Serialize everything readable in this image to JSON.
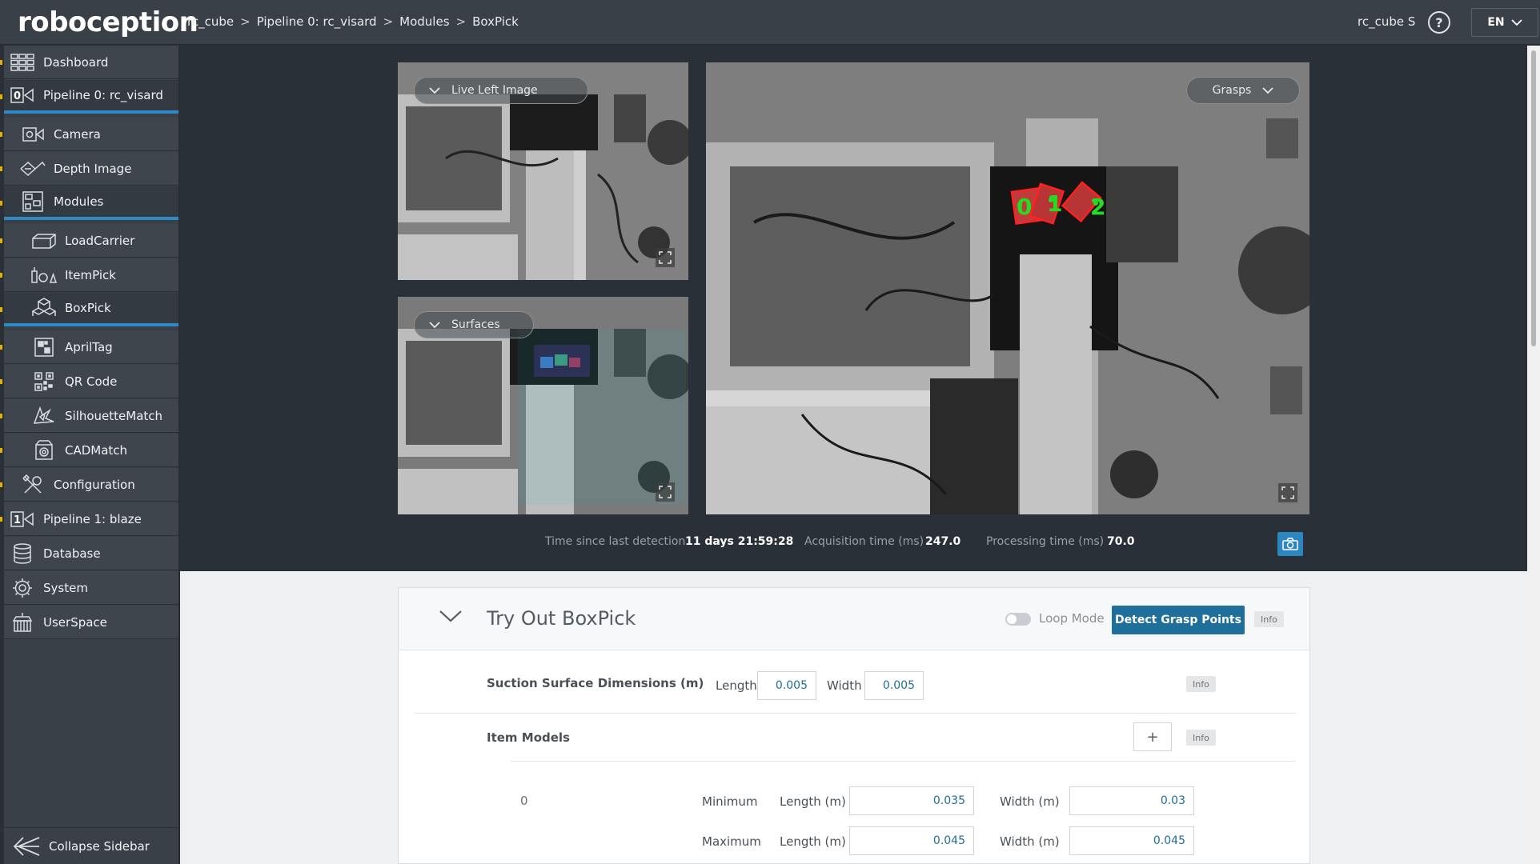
{
  "header": {
    "logo": "roboception",
    "breadcrumb": [
      "rc_cube",
      "Pipeline 0: rc_visard",
      "Modules",
      "BoxPick"
    ],
    "device": "rc_cube S",
    "help_symbol": "?",
    "language": "EN"
  },
  "sidebar": {
    "items": [
      {
        "label": "Dashboard",
        "icon": "dashboard-icon"
      },
      {
        "label": "Pipeline 0: rc_visard",
        "icon": "pipeline-0-icon",
        "badge": "0"
      },
      {
        "label": "Camera",
        "icon": "camera-icon"
      },
      {
        "label": "Depth Image",
        "icon": "depth-image-icon"
      },
      {
        "label": "Modules",
        "icon": "modules-icon"
      },
      {
        "label": "LoadCarrier",
        "icon": "load-carrier-icon"
      },
      {
        "label": "ItemPick",
        "icon": "item-pick-icon"
      },
      {
        "label": "BoxPick",
        "icon": "box-pick-icon"
      },
      {
        "label": "AprilTag",
        "icon": "april-tag-icon"
      },
      {
        "label": "QR Code",
        "icon": "qr-code-icon"
      },
      {
        "label": "SilhouetteMatch",
        "icon": "silhouette-match-icon"
      },
      {
        "label": "CADMatch",
        "icon": "cad-match-icon"
      },
      {
        "label": "Configuration",
        "icon": "configuration-icon"
      },
      {
        "label": "Pipeline 1: blaze",
        "icon": "pipeline-1-icon",
        "badge": "1"
      },
      {
        "label": "Database",
        "icon": "database-icon"
      },
      {
        "label": "System",
        "icon": "gear-icon"
      },
      {
        "label": "UserSpace",
        "icon": "userspace-icon"
      }
    ],
    "collapse_label": "Collapse Sidebar"
  },
  "viewer": {
    "left_top_dropdown": "Live Left Image",
    "left_bottom_dropdown": "Surfaces",
    "right_dropdown": "Grasps",
    "grasp_labels": [
      "0",
      "1",
      "2"
    ],
    "stats": {
      "time_label": "Time since last detection",
      "time_value": "11 days 21:59:28",
      "acq_label": "Acquisition time (ms)",
      "acq_value": "247.0",
      "proc_label": "Processing time (ms)",
      "proc_value": "70.0"
    }
  },
  "tryout": {
    "title": "Try Out BoxPick",
    "loop_mode": "Loop Mode",
    "detect_button": "Detect Grasp Points",
    "info": "Info",
    "suction": {
      "label": "Suction Surface Dimensions (m)",
      "length_label": "Length",
      "length_value": "0.005",
      "width_label": "Width",
      "width_value": "0.005"
    },
    "item_models": {
      "label": "Item Models",
      "add": "+",
      "index": "0",
      "min_label": "Minimum",
      "max_label": "Maximum",
      "length_label": "Length (m)",
      "width_label": "Width (m)",
      "min_length": "0.035",
      "min_width": "0.03",
      "max_length": "0.045",
      "max_width": "0.045"
    }
  },
  "colors": {
    "accent": "#1f6e9c",
    "active_underline": "#2d8ac6",
    "marker": "#e1b400",
    "grasp_red": "#e02020",
    "grasp_green": "#22dd22"
  }
}
